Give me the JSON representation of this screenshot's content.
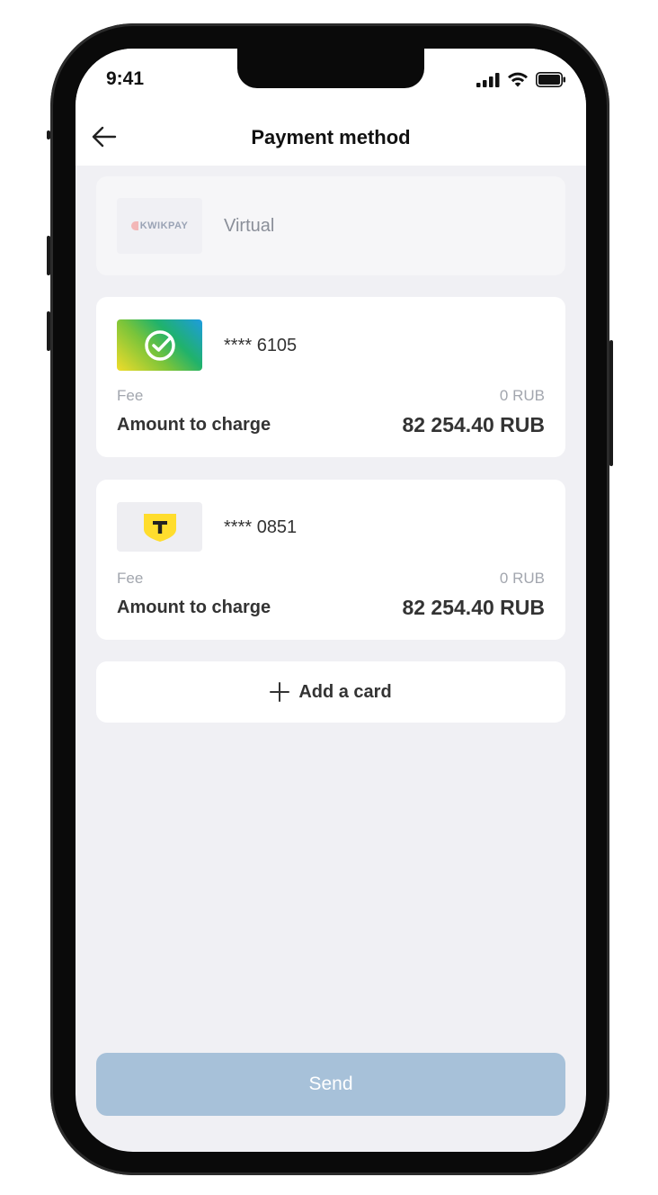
{
  "status_bar": {
    "time": "9:41"
  },
  "header": {
    "title": "Payment method"
  },
  "virtual_card": {
    "label": "Virtual",
    "logo_text": "KWIKPAY"
  },
  "cards": [
    {
      "number": "**** 6105",
      "fee_label": "Fee",
      "fee_value": "0 RUB",
      "amount_label": "Amount to charge",
      "amount_value": "82 254.40 RUB"
    },
    {
      "number": "**** 0851",
      "fee_label": "Fee",
      "fee_value": "0 RUB",
      "amount_label": "Amount to charge",
      "amount_value": "82 254.40 RUB"
    }
  ],
  "add_card": {
    "label": "Add a card"
  },
  "send_button": {
    "label": "Send"
  },
  "icons": {
    "back": "arrow-left-icon",
    "signal": "cellular-signal-icon",
    "wifi": "wifi-icon",
    "battery": "battery-icon",
    "plus": "plus-icon",
    "card_logo_1": "check-circle-icon",
    "card_logo_2": "shield-t-icon"
  },
  "colors": {
    "background": "#f0f0f4",
    "send_button": "#a7c1d9",
    "tbank_yellow": "#ffdd2d"
  }
}
